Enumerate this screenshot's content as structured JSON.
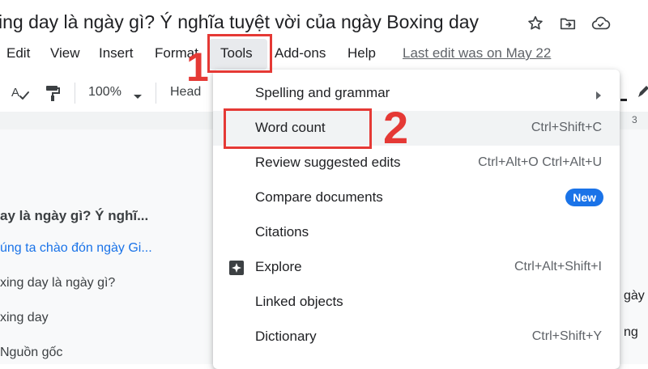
{
  "document": {
    "title": "ing day là ngày gì? Ý nghĩa tuyệt vời của ngày Boxing day"
  },
  "menubar": {
    "items": [
      "Edit",
      "View",
      "Insert",
      "Format",
      "Tools",
      "Add-ons",
      "Help"
    ],
    "last_edit": "Last edit was on May 22"
  },
  "toolbar": {
    "zoom": "100%",
    "style": "Head"
  },
  "ruler": {
    "mark": "3"
  },
  "outline": {
    "items": [
      "ay là ngày gì? Ý nghĩ...",
      "úng ta chào đón ngày Gi...",
      "xing day là ngày gì?",
      "xing day",
      "Nguồn gốc"
    ]
  },
  "side_text": [
    "gày",
    "ng"
  ],
  "tools_menu": {
    "items": [
      {
        "label": "Spelling and grammar",
        "shortcut": "",
        "submenu": true
      },
      {
        "label": "Word count",
        "shortcut": "Ctrl+Shift+C"
      },
      {
        "label": "Review suggested edits",
        "shortcut": "Ctrl+Alt+O Ctrl+Alt+U"
      },
      {
        "label": "Compare documents",
        "badge": "New"
      },
      {
        "label": "Citations",
        "shortcut": ""
      },
      {
        "label": "Explore",
        "shortcut": "Ctrl+Alt+Shift+I"
      },
      {
        "label": "Linked objects",
        "shortcut": ""
      },
      {
        "label": "Dictionary",
        "shortcut": "Ctrl+Shift+Y"
      }
    ]
  },
  "annotations": {
    "step1": "1",
    "step2": "2",
    "color": "#e53935"
  },
  "colors": {
    "accent": "#1a73e8",
    "link": "#1a73e8"
  }
}
